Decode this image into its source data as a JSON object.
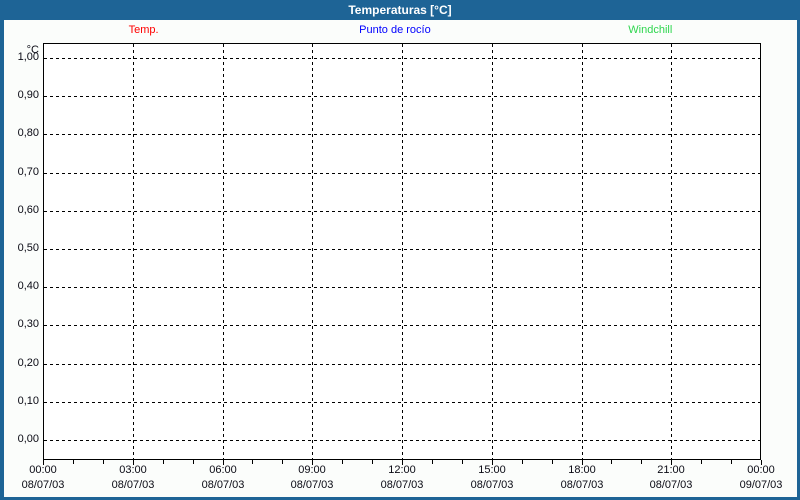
{
  "title": "Temperaturas [°C]",
  "colors": {
    "frame_blue": "#1e6496",
    "plot_border": "#000000",
    "grid": "#000000",
    "background": "#fbfdfb",
    "temp_red": "#ff0000",
    "dewpoint_blue": "#0000ff",
    "windchill_green": "#2fd64f"
  },
  "chart_data": {
    "type": "line",
    "title": "Temperaturas [°C]",
    "ylabel": "°C",
    "ylim": [
      0,
      1
    ],
    "ytick_step": 0.1,
    "ytick_labels": [
      "1,00",
      "0,90",
      "0,80",
      "0,70",
      "0,60",
      "0,50",
      "0,40",
      "0,30",
      "0,20",
      "0,10",
      "0,00"
    ],
    "x_hours_total": 24,
    "major_tick_hours": 3,
    "minor_tick_hours": 1,
    "grid": "dashed",
    "legend_position": "top",
    "xticks": [
      {
        "time": "00:00",
        "date": "08/07/03"
      },
      {
        "time": "03:00",
        "date": "08/07/03"
      },
      {
        "time": "06:00",
        "date": "08/07/03"
      },
      {
        "time": "09:00",
        "date": "08/07/03"
      },
      {
        "time": "12:00",
        "date": "08/07/03"
      },
      {
        "time": "15:00",
        "date": "08/07/03"
      },
      {
        "time": "18:00",
        "date": "08/07/03"
      },
      {
        "time": "21:00",
        "date": "08/07/03"
      },
      {
        "time": "00:00",
        "date": "09/07/03"
      }
    ],
    "series": [
      {
        "name": "Temp.",
        "color": "#ff0000",
        "values": []
      },
      {
        "name": "Punto de rocío",
        "color": "#0000ff",
        "values": []
      },
      {
        "name": "Windchill",
        "color": "#2fd64f",
        "values": []
      }
    ]
  }
}
